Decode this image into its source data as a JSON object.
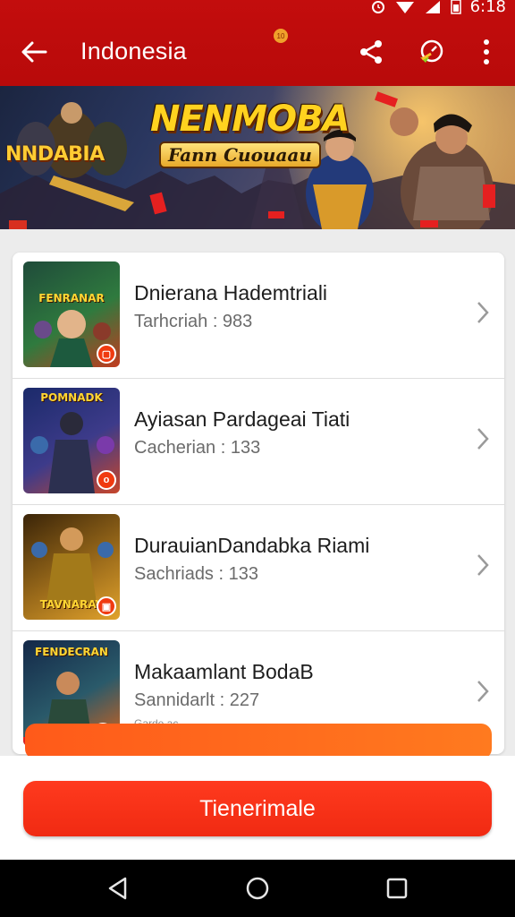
{
  "status_bar": {
    "time": "6:18"
  },
  "app_bar": {
    "title": "Indonesia",
    "notif_badge": "10",
    "back_icon": "arrow-left-icon",
    "share_icon": "share-icon",
    "refresh_icon": "refresh-icon",
    "more_icon": "more-vert-icon"
  },
  "banner": {
    "title": "NENMOBA",
    "subtitle": "Fann Cuouaau",
    "logo": "NNDABIA"
  },
  "list": {
    "items": [
      {
        "title": "Dnierana Hademtriali",
        "meta": "Tarhcriah : 983",
        "thumb_text": "FENRANAR",
        "badge": "",
        "colors": [
          "#1f4b3a",
          "#2f7a3e",
          "#c23b1f"
        ]
      },
      {
        "title": "Ayiasan Pardagеai Tiati",
        "meta": "Cacherian : 133",
        "thumb_text": "POMNADK",
        "badge": "",
        "colors": [
          "#1b2a6a",
          "#3d3b8a",
          "#c8462a"
        ]
      },
      {
        "title": "DurauianDandabka Riami",
        "meta": "Sachriads : 133",
        "thumb_text": "TAVNARAY",
        "badge": "",
        "colors": [
          "#3a2408",
          "#9a6a1a",
          "#e0a22c"
        ]
      },
      {
        "title": "Makaamlant BodaB",
        "meta": "Sannidarlt : 227",
        "extra": "Garde ac",
        "thumb_text": "FENDECRAN",
        "badge": "",
        "colors": [
          "#142848",
          "#2a5a6a",
          "#d8621a"
        ]
      }
    ]
  },
  "primary_button": {
    "label": "Tienerimale"
  },
  "nav": {
    "back_icon": "nav-back-icon",
    "home_icon": "nav-home-icon",
    "recents_icon": "nav-recents-icon"
  },
  "colors": {
    "app_bar": "#c30d0d",
    "accent": "#f02a12",
    "orange": "#ff6a1d"
  }
}
